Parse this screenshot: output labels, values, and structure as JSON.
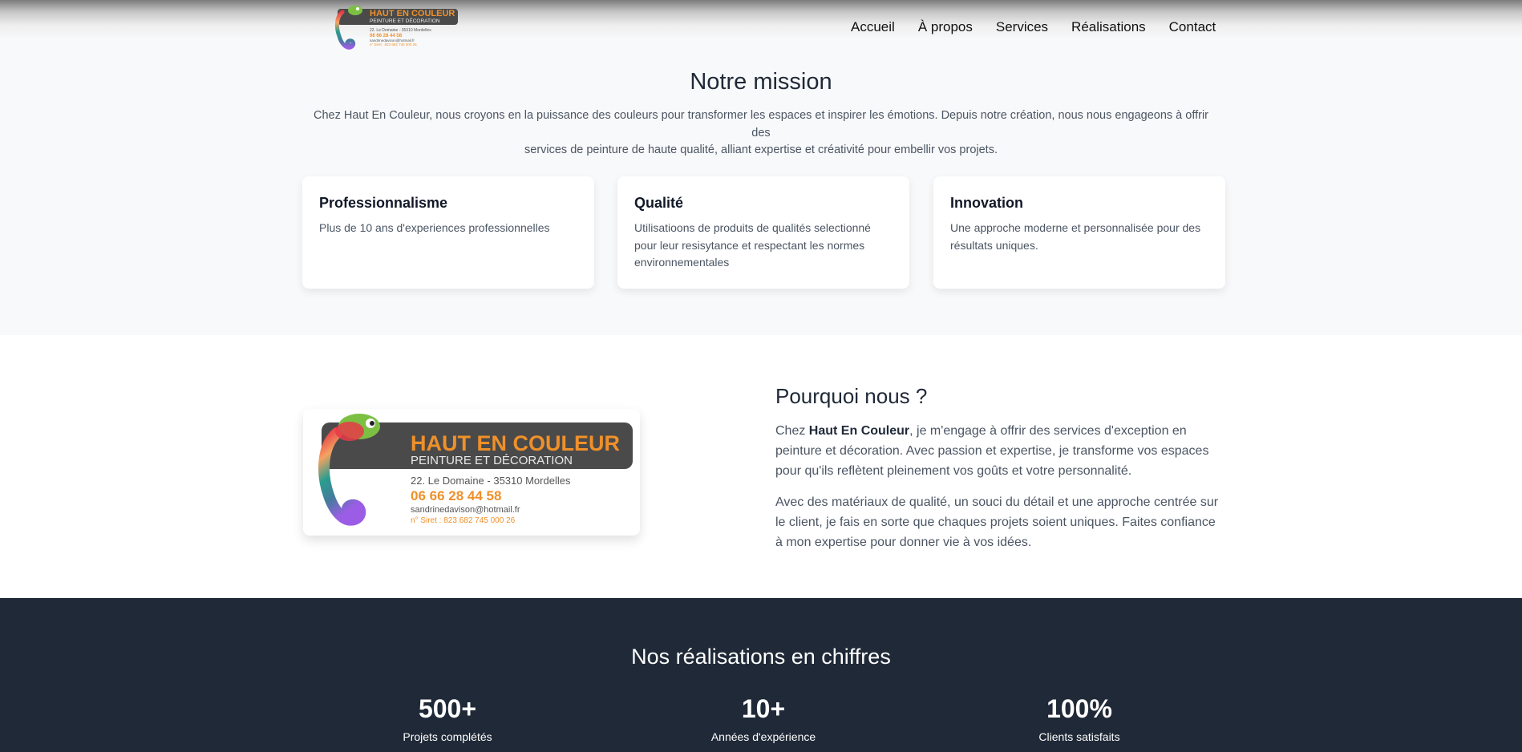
{
  "nav": {
    "items": [
      "Accueil",
      "À propos",
      "Services",
      "Réalisations",
      "Contact"
    ]
  },
  "logo": {
    "name": "HAUT EN COULEUR",
    "tagline": "PEINTURE ET DÉCORATION",
    "address": "22. Le Domaine - 35310 Mordelles",
    "phone": "06 66 28 44 58",
    "email": "sandrinedavison@hotmail.fr",
    "siret": "n° Siret : 823 682 745 000 26"
  },
  "mission": {
    "title": "Notre mission",
    "text_line1": "Chez Haut En Couleur, nous croyons en la puissance des couleurs pour transformer les espaces et inspirer les émotions. Depuis notre création, nous nous engageons à offrir des",
    "text_line2": "services de peinture de haute qualité, alliant expertise et créativité pour embellir vos projets.",
    "cards": [
      {
        "title": "Professionnalisme",
        "text": "Plus de 10 ans d'experiences professionnelles"
      },
      {
        "title": "Qualité",
        "text": "Utilisatioons de produits de qualités selectionné pour leur resisytance et respectant les normes environnementales"
      },
      {
        "title": "Innovation",
        "text": "Une approche moderne et personnalisée pour des résultats uniques."
      }
    ]
  },
  "why": {
    "title": "Pourquoi nous ?",
    "p1_prefix": "Chez ",
    "p1_bold": "Haut En Couleur",
    "p1_rest": ", je m'engage à offrir des services d'exception en peinture et décoration. Avec passion et expertise, je transforme vos espaces pour qu'ils reflètent pleinement vos goûts et votre personnalité.",
    "p2": "Avec des matériaux de qualité, un souci du détail et une approche centrée sur le client, je fais en sorte que chaques projets soient uniques. Faites confiance à mon expertise pour donner vie à vos idées."
  },
  "stats": {
    "title": "Nos réalisations en chiffres",
    "items": [
      {
        "value": "500+",
        "label": "Projets complétés"
      },
      {
        "value": "10+",
        "label": "Années d'expérience"
      },
      {
        "value": "100%",
        "label": "Clients satisfaits"
      }
    ]
  },
  "colors": {
    "dark": "#1f2937",
    "logo_orange": "#f0902a",
    "logo_bar": "#4a4a4a"
  }
}
